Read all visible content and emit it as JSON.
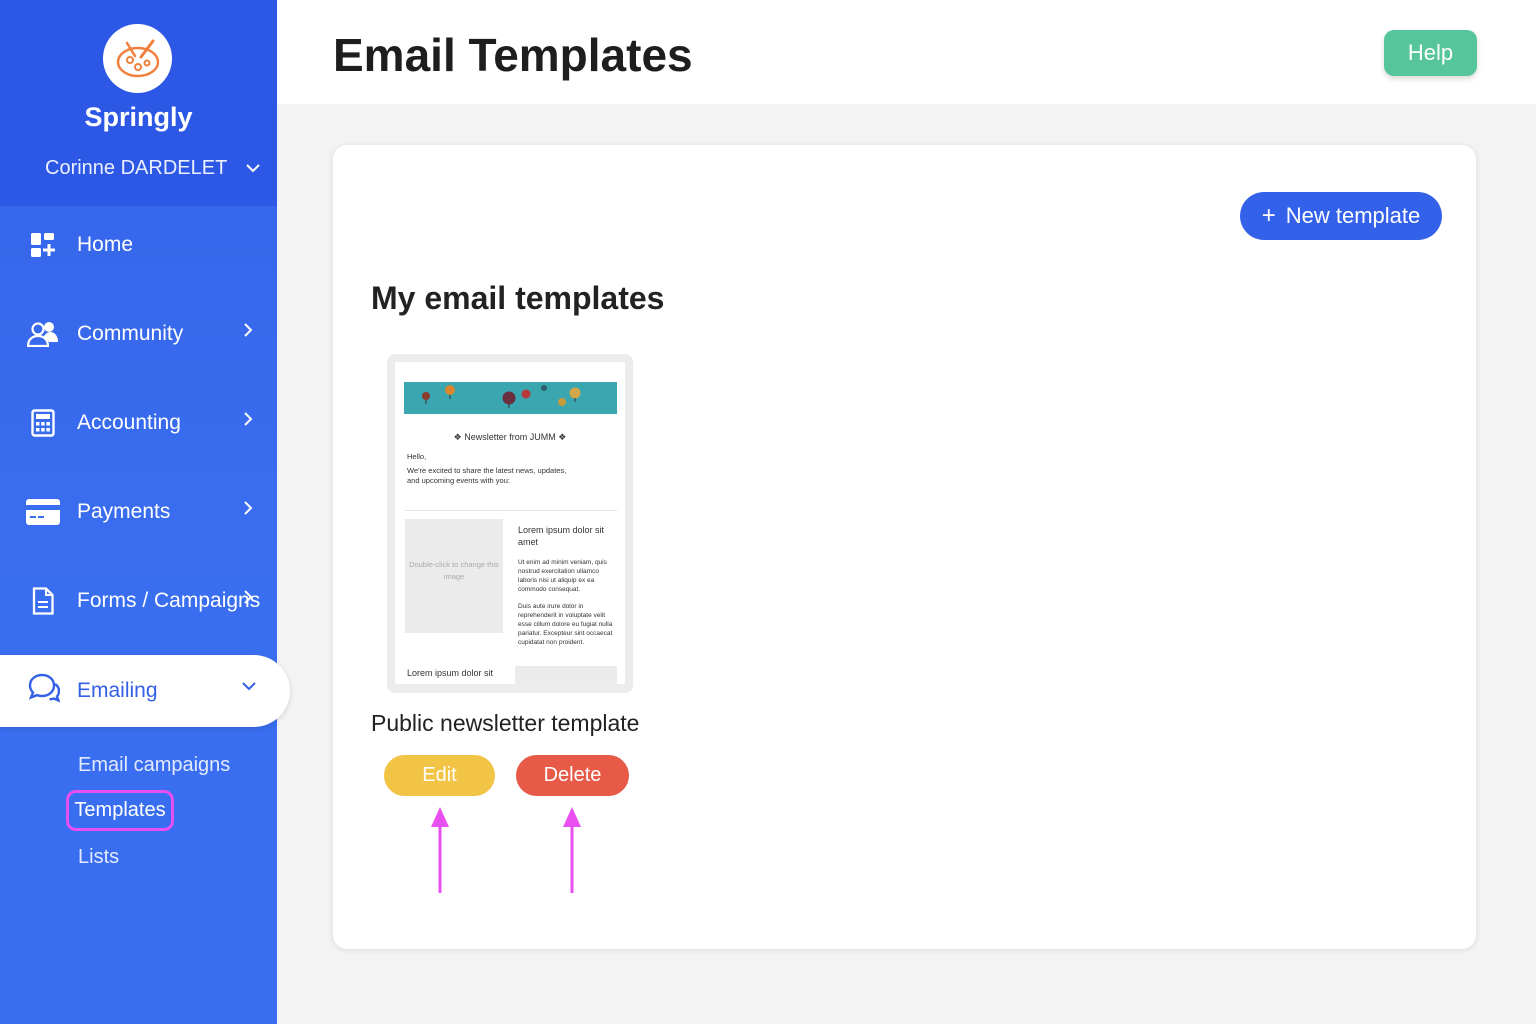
{
  "sidebar": {
    "brand_name": "Springly",
    "user_name": "Corinne DARDELET",
    "items": [
      {
        "label": "Home",
        "icon": "dashboard-grid-icon"
      },
      {
        "label": "Community",
        "icon": "users-icon"
      },
      {
        "label": "Accounting",
        "icon": "calculator-icon"
      },
      {
        "label": "Payments",
        "icon": "credit-card-icon"
      },
      {
        "label": "Forms / Campaigns",
        "icon": "document-icon"
      },
      {
        "label": "Emailing",
        "icon": "chat-bubbles-icon"
      }
    ],
    "subitems": [
      {
        "label": "Email campaigns"
      },
      {
        "label": "Templates"
      },
      {
        "label": "Lists"
      }
    ],
    "accent_color": "#3461ea"
  },
  "header": {
    "title": "Email Templates",
    "help_label": "Help"
  },
  "main": {
    "new_template_label": "New template",
    "section_title": "My email templates",
    "template": {
      "name": "Public newsletter template",
      "edit_label": "Edit",
      "delete_label": "Delete",
      "preview": {
        "heading": "❖ Newsletter from JUMM ❖",
        "greeting": "Hello,",
        "intro": "We're excited to share the latest news, updates, and upcoming events with you:",
        "image_placeholder": "Double-click to change this image",
        "col_title": "Lorem ipsum dolor sit amet",
        "col_para1": "Ut enim ad minim veniam, quis nostrud exercitation ullamco laboris nisi ut aliquip ex ea commodo consequat.",
        "col_para2": "Duis aute irure dolor in reprehenderit in voluptate velit esse cillum dolore eu fugiat nulla pariatur. Excepteur sint occaecat cupidatat non proident.",
        "footer_title": "Lorem ipsum dolor sit"
      }
    }
  }
}
